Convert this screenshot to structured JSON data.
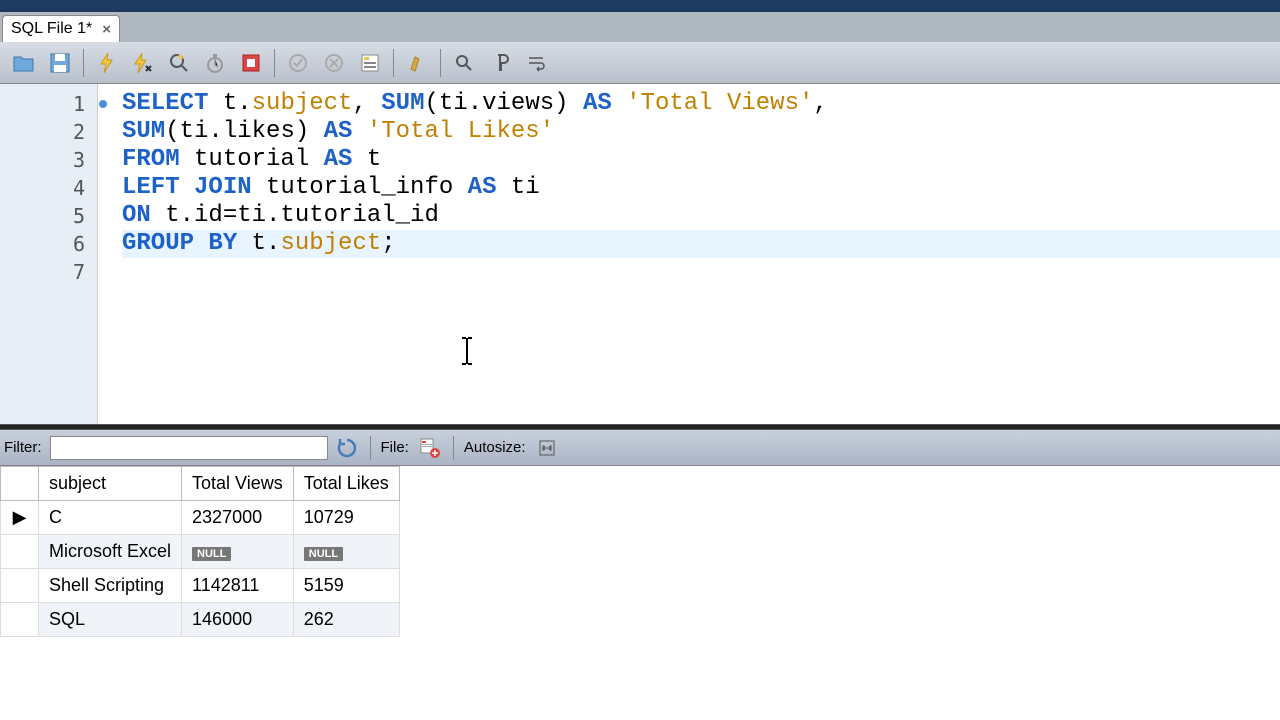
{
  "tab": {
    "title": "SQL File 1*"
  },
  "toolbar": {
    "icons": [
      "folder",
      "save",
      "bolt",
      "bolt-cursor",
      "magnifier",
      "stopwatch",
      "stop",
      "check",
      "cancel",
      "form",
      "brush",
      "search",
      "paragraph",
      "wrap"
    ]
  },
  "editor": {
    "lines": [
      {
        "n": "1",
        "modified": true,
        "tokens": [
          {
            "t": "SELECT",
            "c": "kw"
          },
          {
            "t": " t.",
            "c": ""
          },
          {
            "t": "subject",
            "c": "ident"
          },
          {
            "t": ", ",
            "c": ""
          },
          {
            "t": "SUM",
            "c": "fn"
          },
          {
            "t": "(ti.views) ",
            "c": ""
          },
          {
            "t": "AS",
            "c": "kw"
          },
          {
            "t": " ",
            "c": ""
          },
          {
            "t": "'Total Views'",
            "c": "str"
          },
          {
            "t": ",",
            "c": ""
          }
        ]
      },
      {
        "n": "2",
        "tokens": [
          {
            "t": "SUM",
            "c": "fn"
          },
          {
            "t": "(ti.likes) ",
            "c": ""
          },
          {
            "t": "AS",
            "c": "kw"
          },
          {
            "t": " ",
            "c": ""
          },
          {
            "t": "'Total Likes'",
            "c": "str"
          }
        ]
      },
      {
        "n": "3",
        "tokens": [
          {
            "t": "FROM",
            "c": "kw"
          },
          {
            "t": " tutorial ",
            "c": ""
          },
          {
            "t": "AS",
            "c": "kw"
          },
          {
            "t": " t",
            "c": ""
          }
        ]
      },
      {
        "n": "4",
        "tokens": [
          {
            "t": "LEFT JOIN",
            "c": "kw"
          },
          {
            "t": " tutorial_info ",
            "c": ""
          },
          {
            "t": "AS",
            "c": "kw"
          },
          {
            "t": " ti",
            "c": ""
          }
        ]
      },
      {
        "n": "5",
        "tokens": [
          {
            "t": "ON",
            "c": "kw"
          },
          {
            "t": " t.id=ti.tutorial_id",
            "c": ""
          }
        ]
      },
      {
        "n": "6",
        "highlight": true,
        "tokens": [
          {
            "t": "GROUP BY",
            "c": "kw"
          },
          {
            "t": " t.",
            "c": ""
          },
          {
            "t": "subject",
            "c": "ident"
          },
          {
            "t": ";",
            "c": ""
          }
        ]
      },
      {
        "n": "7",
        "tokens": []
      }
    ]
  },
  "results": {
    "filter_label": "Filter:",
    "filter_value": "",
    "file_label": "File:",
    "autosize_label": "Autosize:",
    "columns": [
      "subject",
      "Total Views",
      "Total Likes"
    ],
    "rows": [
      {
        "active": true,
        "cells": [
          "C",
          "2327000",
          "10729"
        ]
      },
      {
        "cells": [
          "Microsoft Excel",
          null,
          null
        ]
      },
      {
        "cells": [
          "Shell Scripting",
          "1142811",
          "5159"
        ]
      },
      {
        "cells": [
          "SQL",
          "146000",
          "262"
        ]
      }
    ],
    "null_label": "NULL"
  }
}
